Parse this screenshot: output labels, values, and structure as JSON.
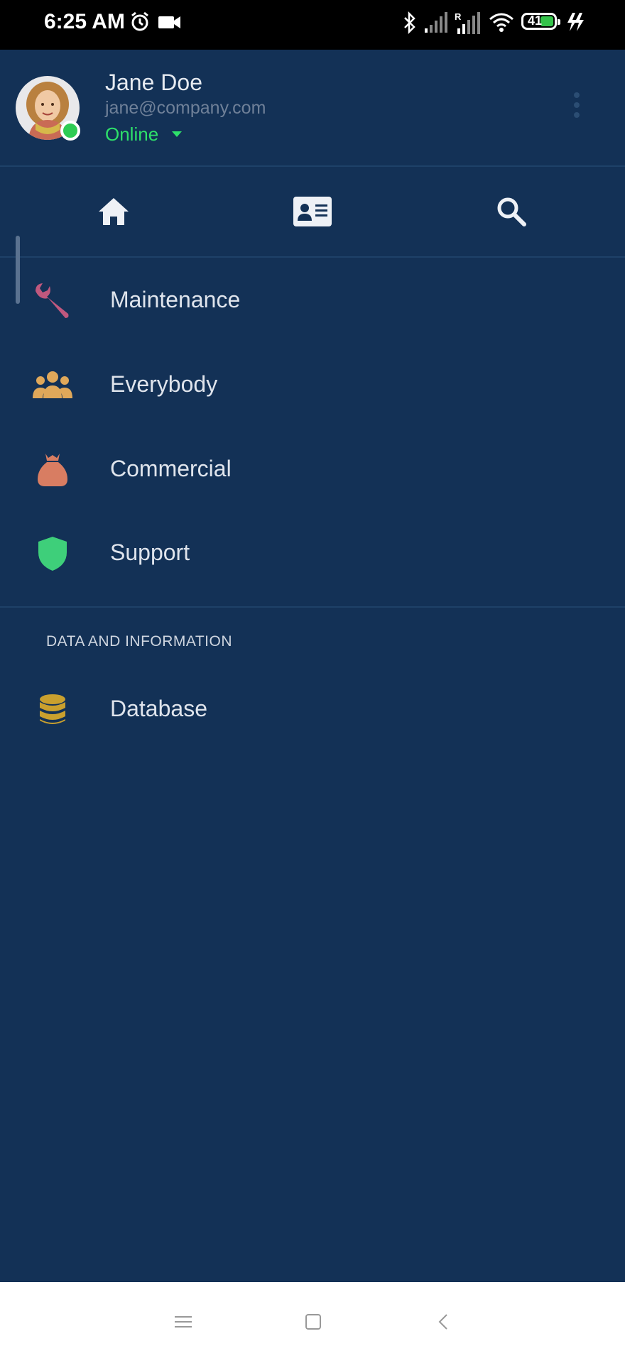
{
  "status_bar": {
    "time": "6:25 AM",
    "battery_level": "41",
    "icons": [
      "alarm-icon",
      "video-icon",
      "bluetooth-icon",
      "signal-icon",
      "signal-roaming-icon",
      "wifi-icon",
      "battery-icon",
      "charging-icon"
    ]
  },
  "profile": {
    "name": "Jane Doe",
    "email": "jane@company.com",
    "status": "Online",
    "status_color": "#2ee06a"
  },
  "tabs": [
    {
      "icon": "home-icon"
    },
    {
      "icon": "contact-card-icon"
    },
    {
      "icon": "search-icon"
    }
  ],
  "menu": {
    "items": [
      {
        "label": "Maintenance",
        "icon": "wrench-icon",
        "color": "#c0587e"
      },
      {
        "label": "Everybody",
        "icon": "users-icon",
        "color": "#e0a85a"
      },
      {
        "label": "Commercial",
        "icon": "money-bag-icon",
        "color": "#d87d62"
      },
      {
        "label": "Support",
        "icon": "shield-icon",
        "color": "#3ecf7a"
      }
    ],
    "section_title": "DATA AND INFORMATION",
    "section_items": [
      {
        "label": "Database",
        "icon": "database-icon",
        "color": "#c9a02e"
      }
    ]
  },
  "colors": {
    "background": "#133156",
    "divider": "#1e4168"
  }
}
